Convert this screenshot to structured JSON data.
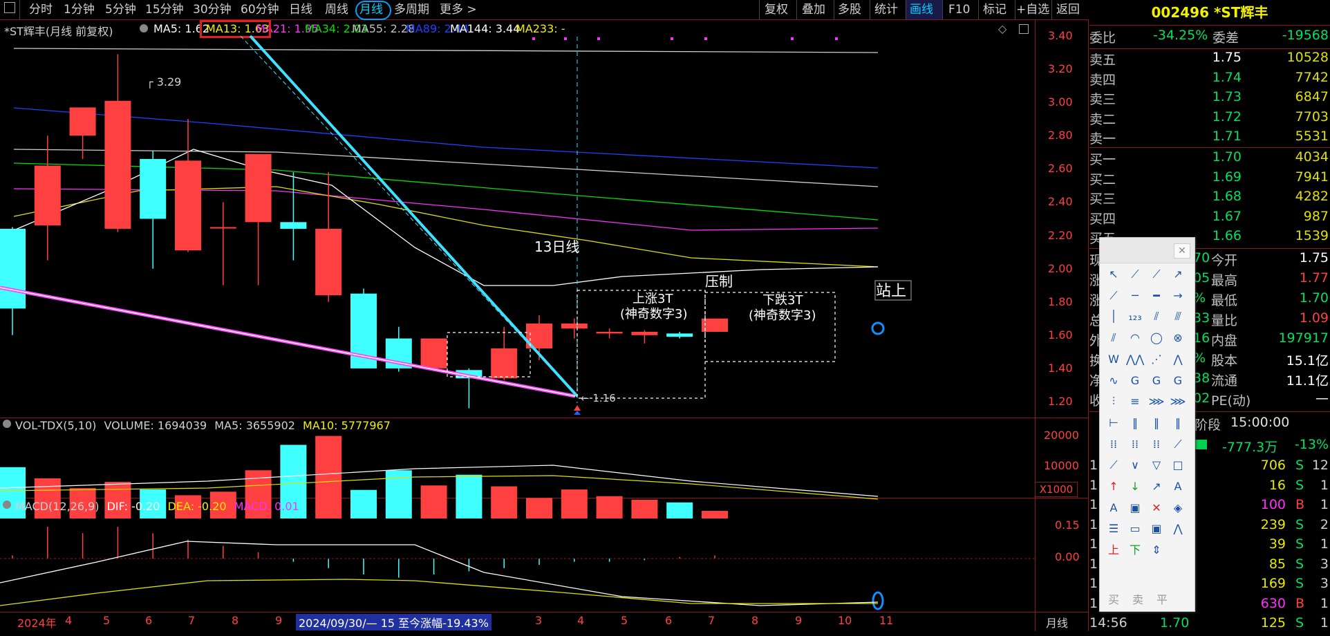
{
  "toolbar": {
    "left_icon": "window-icon",
    "periods": [
      "分时",
      "1分钟",
      "5分钟",
      "15分钟",
      "30分钟",
      "60分钟",
      "日线",
      "周线",
      "月线",
      "多周期",
      "更多 >"
    ],
    "active_period": "月线",
    "right_buttons": [
      "复权",
      "叠加",
      "多股",
      "统计",
      "画线",
      "F10",
      "标记",
      "+自选",
      "返回"
    ],
    "active_right": "画线"
  },
  "chart_header": {
    "stock_name": "*ST辉丰(月线 前复权)",
    "ma_labels": [
      {
        "text": "MA5: 1.62",
        "color": "#ffffff"
      },
      {
        "text": "MA13: 1.63",
        "color": "#f0f000"
      },
      {
        "text": "MA21: 1.95",
        "color": "#ff30ff"
      },
      {
        "text": "MA34: 2.03",
        "color": "#00e000"
      },
      {
        "text": "MA55: 2.28",
        "color": "#c0c0c0"
      },
      {
        "text": "MA89: 2.44",
        "color": "#2040ff"
      },
      {
        "text": "MA144: 3.44",
        "color": "#ffffff"
      },
      {
        "text": "MA233: -",
        "color": "#f0f000"
      }
    ]
  },
  "price_axis": [
    "3.40",
    "3.20",
    "3.00",
    "2.80",
    "2.60",
    "2.40",
    "2.20",
    "2.00",
    "1.80",
    "1.60",
    "1.40",
    "1.20"
  ],
  "annotations": {
    "high_label": "3.29",
    "low_label": "1.16",
    "ma13_text": "13日线",
    "pressure": "压制",
    "up_line1": "上涨3T",
    "up_line2": "(神奇数字3)",
    "down_line1": "下跌3T",
    "down_line2": "(神奇数字3)",
    "stand_on": "站上"
  },
  "volume_panel": {
    "label": "VOL-TDX(5,10)",
    "volume": "VOLUME: 1694039",
    "ma5": "MA5: 3655902",
    "ma10": "MA10: 5777967",
    "axis": [
      "20000",
      "10000"
    ],
    "unit": "X1000"
  },
  "macd_panel": {
    "label": "MACD(12,26,9)",
    "dif": "DIF: -0.20",
    "dea": "DEA: -0.20",
    "macd": "MACD: 0.01",
    "axis": [
      "0.15",
      "0.00"
    ]
  },
  "time_axis": {
    "labels": [
      "2024年",
      "4",
      "5",
      "6",
      "7",
      "8",
      "9",
      "2024/09/30/— 15 至今涨幅-19.43%",
      "3",
      "4",
      "5",
      "6",
      "7",
      "8",
      "9",
      "10",
      "11"
    ],
    "period_label": "月线"
  },
  "quote": {
    "title": "002496 *ST辉丰",
    "weibi_label": "委比",
    "weibi_value": "-34.25%",
    "weicha_label": "委差",
    "weicha_value": "-19568",
    "asks": [
      {
        "label": "卖五",
        "price": "1.75",
        "vol": "10528"
      },
      {
        "label": "卖四",
        "price": "1.74",
        "vol": "7742"
      },
      {
        "label": "卖三",
        "price": "1.73",
        "vol": "6847"
      },
      {
        "label": "卖二",
        "price": "1.72",
        "vol": "7703"
      },
      {
        "label": "卖一",
        "price": "1.71",
        "vol": "5531"
      }
    ],
    "bids": [
      {
        "label": "买一",
        "price": "1.70",
        "vol": "4034"
      },
      {
        "label": "买二",
        "price": "1.69",
        "vol": "7941"
      },
      {
        "label": "买三",
        "price": "1.68",
        "vol": "4282"
      },
      {
        "label": "买四",
        "price": "1.67",
        "vol": "987"
      },
      {
        "label": "买五",
        "price": "1.66",
        "vol": "1539"
      }
    ],
    "stats": [
      {
        "l1": "现",
        "v1": "70",
        "l2": "今开",
        "v2": "1.75"
      },
      {
        "l1": "涨",
        "v1": "05",
        "l2": "最高",
        "v2": "1.77"
      },
      {
        "l1": "涨",
        "v1": "%",
        "l2": "最低",
        "v2": "1.70"
      },
      {
        "l1": "总",
        "v1": "33",
        "l2": "量比",
        "v2": "1.09"
      },
      {
        "l1": "外",
        "v1": "16",
        "l2": "内盘",
        "v2": "197917"
      },
      {
        "l1": "换",
        "v1": "%",
        "l2": "股本",
        "v2": "15.1亿"
      },
      {
        "l1": "净",
        "v1": "38",
        "l2": "流通",
        "v2": "11.1亿"
      },
      {
        "l1": "收",
        "v1": "02",
        "l2": "PE(动)",
        "v2": "—"
      }
    ],
    "stage_label": "阶段",
    "stage_time": "15:00:00",
    "flow_value": "-777.3万",
    "flow_pct": "-13%",
    "ticks": [
      {
        "price": "",
        "vol": "706",
        "side": "S",
        "n": "12"
      },
      {
        "price": "",
        "vol": "16",
        "side": "S",
        "n": "1"
      },
      {
        "price": "",
        "vol": "100",
        "side": "B",
        "n": "1"
      },
      {
        "price": "",
        "vol": "239",
        "side": "S",
        "n": "2"
      },
      {
        "price": "",
        "vol": "39",
        "side": "S",
        "n": "1"
      },
      {
        "price": "",
        "vol": "85",
        "side": "S",
        "n": "3"
      },
      {
        "price": "",
        "vol": "169",
        "side": "S",
        "n": "3"
      },
      {
        "price": "",
        "vol": "630",
        "side": "B",
        "n": "1"
      },
      {
        "time": "14:56",
        "price": "1.70",
        "vol": "125",
        "side": "S",
        "n": "1"
      }
    ]
  },
  "palette": {
    "bottom": [
      "买",
      "卖",
      "平"
    ]
  },
  "chart_data": {
    "type": "candlestick",
    "title": "*ST辉丰(月线 前复权)",
    "x": [
      "2024-03",
      "2024-04",
      "2024-05",
      "2024-06",
      "2024-07",
      "2024-08",
      "2024-09",
      "2024-10",
      "2024-11",
      "2024-12",
      "2025-01",
      "2025-02",
      "2025-03",
      "2025-04",
      "2025-05",
      "2025-06",
      "2025-07",
      "2025-08",
      "2025-09",
      "2025-10",
      "2025-11"
    ],
    "ohlc": [
      [
        2.24,
        2.25,
        1.6,
        1.76
      ],
      [
        2.26,
        2.8,
        2.05,
        2.62
      ],
      [
        2.8,
        2.88,
        2.66,
        2.97
      ],
      [
        2.24,
        3.29,
        2.22,
        3.01
      ],
      [
        2.66,
        2.71,
        2.0,
        2.3
      ],
      [
        2.11,
        2.9,
        2.1,
        2.65
      ],
      [
        2.25,
        2.4,
        1.9,
        2.25
      ],
      [
        2.28,
        2.42,
        1.9,
        2.69
      ],
      [
        2.28,
        2.58,
        2.05,
        2.24
      ],
      [
        1.84,
        2.58,
        1.8,
        2.24
      ],
      [
        1.85,
        1.88,
        1.4,
        1.4
      ],
      [
        1.58,
        1.65,
        1.38,
        1.4
      ],
      [
        1.4,
        1.58,
        1.4,
        1.58
      ],
      [
        1.39,
        1.4,
        1.16,
        1.34
      ],
      [
        1.34,
        1.65,
        1.33,
        1.52
      ],
      [
        1.52,
        1.72,
        1.45,
        1.67
      ],
      [
        1.64,
        1.7,
        1.58,
        1.67
      ],
      [
        1.61,
        1.64,
        1.58,
        1.62
      ],
      [
        1.6,
        1.63,
        1.55,
        1.62
      ],
      [
        1.61,
        1.62,
        1.58,
        1.59
      ],
      [
        1.62,
        1.7,
        1.62,
        1.7
      ]
    ],
    "ylim": [
      1.1,
      3.5
    ],
    "volume": [
      11500,
      9000,
      6800,
      8200,
      6500,
      5200,
      6000,
      10800,
      16500,
      18500,
      6400,
      10800,
      7400,
      9800,
      7200,
      4600,
      6500,
      5000,
      4200,
      3600,
      1700
    ],
    "volume_ylim": [
      0,
      22000
    ],
    "macd_hist": [
      0.01,
      0.1,
      0.08,
      0.1,
      0.08,
      0.06,
      0.04,
      0.02,
      -0.01,
      -0.03,
      -0.05,
      -0.06,
      -0.05,
      -0.04,
      -0.03,
      -0.02,
      -0.01,
      -0.01,
      -0.005,
      0.005,
      0.01
    ],
    "macd_ylim": [
      -0.22,
      0.2
    ]
  }
}
